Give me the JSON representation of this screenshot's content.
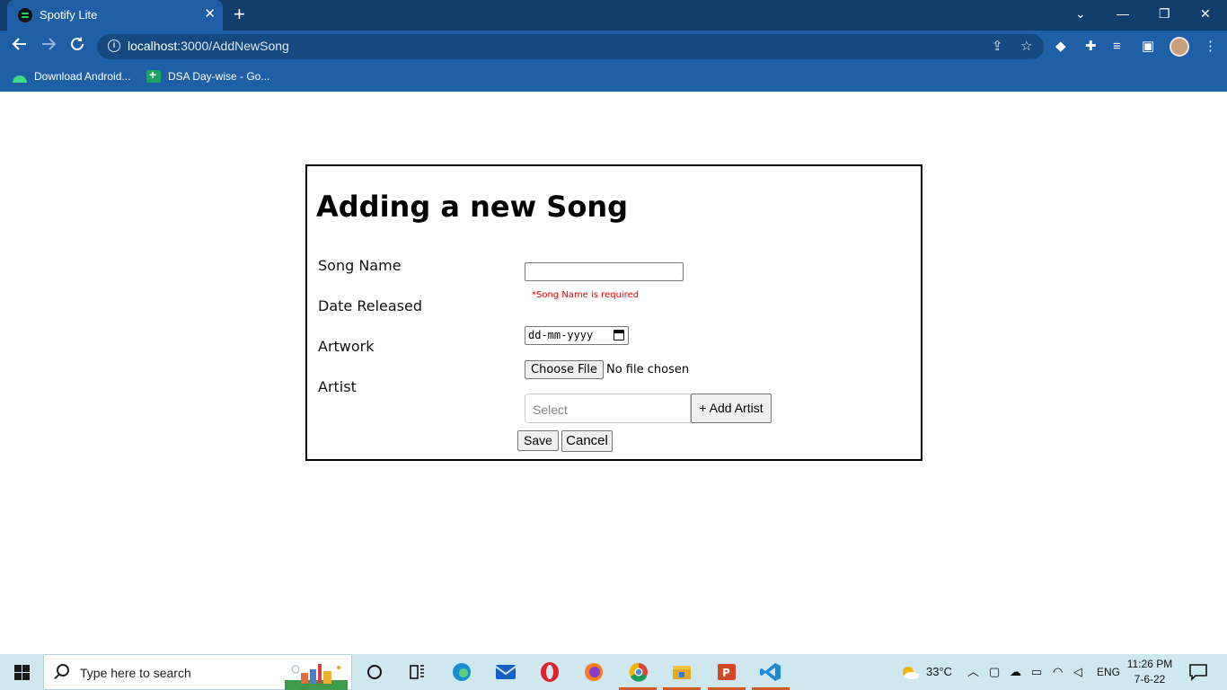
{
  "browser": {
    "tab_title": "Spotify Lite",
    "tab_close": "✕",
    "new_tab": "+",
    "url_host": "localhost",
    "url_rest": ":3000/AddNewSong",
    "bookmarks": [
      {
        "label": "Download Android..."
      },
      {
        "label": "DSA Day-wise - Go..."
      }
    ],
    "window_controls": {
      "chevron": "⌄",
      "minimize": "—",
      "restore": "❐",
      "close": "✕"
    }
  },
  "form": {
    "title": "Adding a new Song",
    "labels": {
      "song_name": "Song Name",
      "date_released": "Date Released",
      "artwork": "Artwork",
      "artist": "Artist"
    },
    "song_name_value": "",
    "song_name_error": "*Song Name is required",
    "date_placeholder": "dd-mm-yyyy",
    "choose_file_label": "Choose File",
    "file_status": "No file chosen",
    "artist_placeholder": "Select",
    "add_artist_label": "+ Add Artist",
    "save_label": "Save",
    "cancel_label": "Cancel"
  },
  "taskbar": {
    "search_placeholder": "Type here to search",
    "temperature": "33°C",
    "language": "ENG",
    "time": "11:26 PM",
    "date": "7-6-22"
  },
  "colors": {
    "tabbar": "#123e6e",
    "toolbar": "#1f5fa6",
    "error": "#e00000",
    "taskbar": "#cfe7ee"
  }
}
